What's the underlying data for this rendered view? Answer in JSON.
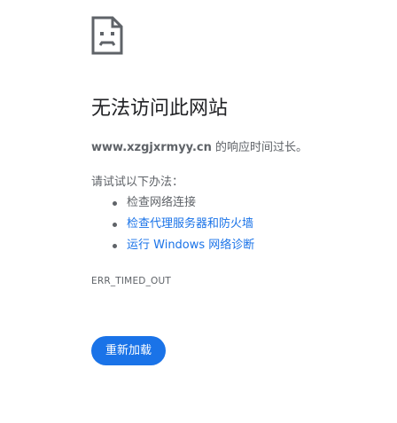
{
  "icon": {
    "name": "sad-page-icon"
  },
  "title": "无法访问此网站",
  "summary": {
    "host": "www.xzgjxrmyy.cn",
    "message": " 的响应时间过长。"
  },
  "suggestions": {
    "heading": "请试试以下办法：",
    "items": [
      {
        "label": "检查网络连接",
        "link": false
      },
      {
        "label": "检查代理服务器和防火墙",
        "link": true
      },
      {
        "label": "运行 Windows 网络诊断",
        "link": true
      }
    ]
  },
  "error_code": "ERR_TIMED_OUT",
  "reload_button": {
    "label": "重新加载"
  },
  "colors": {
    "accent": "#1a73e8",
    "text_secondary": "#5f6368",
    "text_primary": "#202124"
  }
}
